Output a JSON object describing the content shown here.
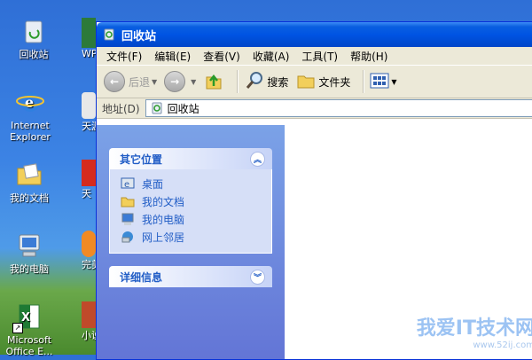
{
  "desktop": {
    "icons": [
      {
        "label": "回收站"
      },
      {
        "label": "Internet Explorer"
      },
      {
        "label": "我的文档"
      },
      {
        "label": "我的电脑"
      },
      {
        "label": "Microsoft Office E..."
      }
    ],
    "partial_icons": [
      "WPS",
      "天涯",
      "天",
      "完美",
      "小说"
    ]
  },
  "window": {
    "title": "回收站",
    "menu": [
      "文件(F)",
      "编辑(E)",
      "查看(V)",
      "收藏(A)",
      "工具(T)",
      "帮助(H)"
    ],
    "toolbar": {
      "back_label": "后退",
      "search_label": "搜索",
      "folders_label": "文件夹"
    },
    "address": {
      "label": "地址(D)",
      "value": "回收站"
    },
    "taskpane": {
      "other_places": {
        "title": "其它位置",
        "links": [
          "桌面",
          "我的文档",
          "我的电脑",
          "网上邻居"
        ]
      },
      "details": {
        "title": "详细信息"
      }
    },
    "watermark": {
      "text": "我爱IT技术网",
      "url": "www.52ij.com"
    }
  },
  "colors": {
    "title_blue": "#0054e3",
    "link_blue": "#215dc6",
    "taskpane_blue": "#6375d6"
  }
}
